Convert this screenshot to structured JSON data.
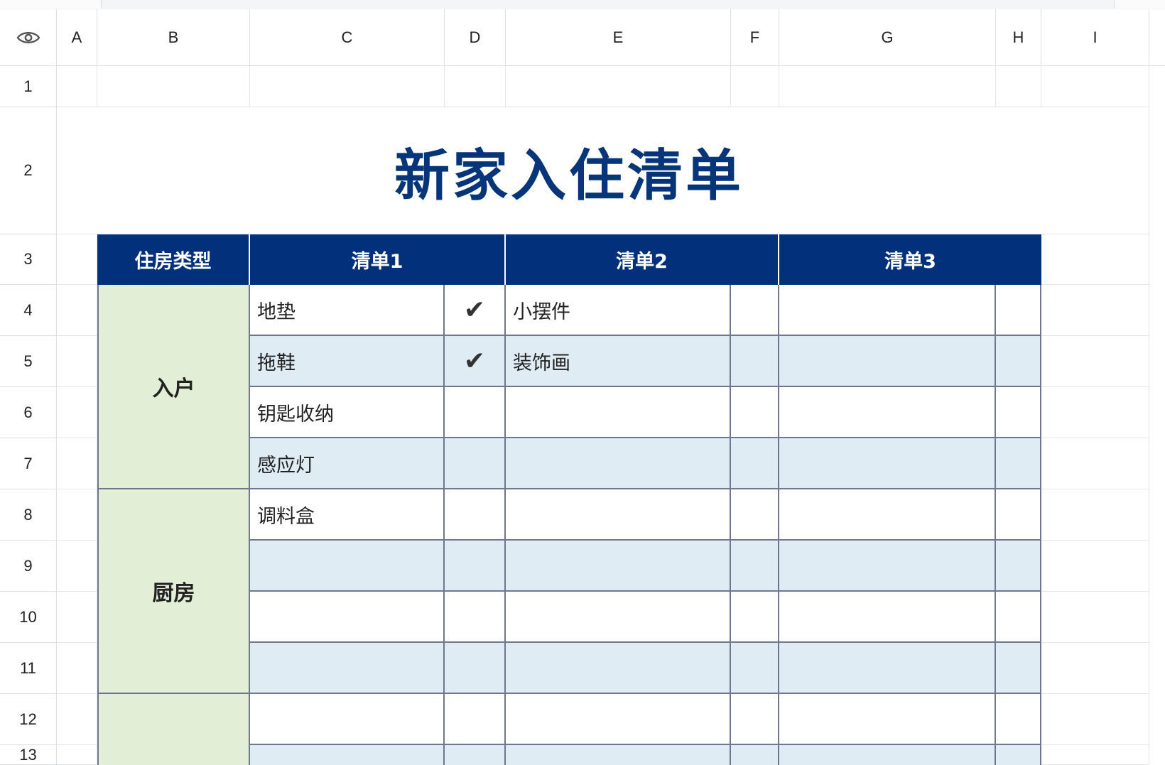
{
  "columns": [
    "A",
    "B",
    "C",
    "D",
    "E",
    "F",
    "G",
    "H",
    "I"
  ],
  "rows": [
    "1",
    "2",
    "3",
    "4",
    "5",
    "6",
    "7",
    "8",
    "9",
    "10",
    "11",
    "12",
    "13"
  ],
  "title": "新家入住清单",
  "table_header": {
    "housing_type": "住房类型",
    "list1": "清单1",
    "list2": "清单2",
    "list3": "清单3"
  },
  "categories": {
    "entry": "入户",
    "kitchen": "厨房"
  },
  "list1_items": [
    "地垫",
    "拖鞋",
    "钥匙收纳",
    "感应灯",
    "调料盒"
  ],
  "list2_items": [
    "小摆件",
    "装饰画"
  ],
  "check_mark": "✔",
  "colors": {
    "header_bg": "#03307a",
    "title": "#06357a",
    "category_bg": "#e2eed6",
    "row_alt_bg": "#dfecf4",
    "table_border": "#6f7690"
  }
}
